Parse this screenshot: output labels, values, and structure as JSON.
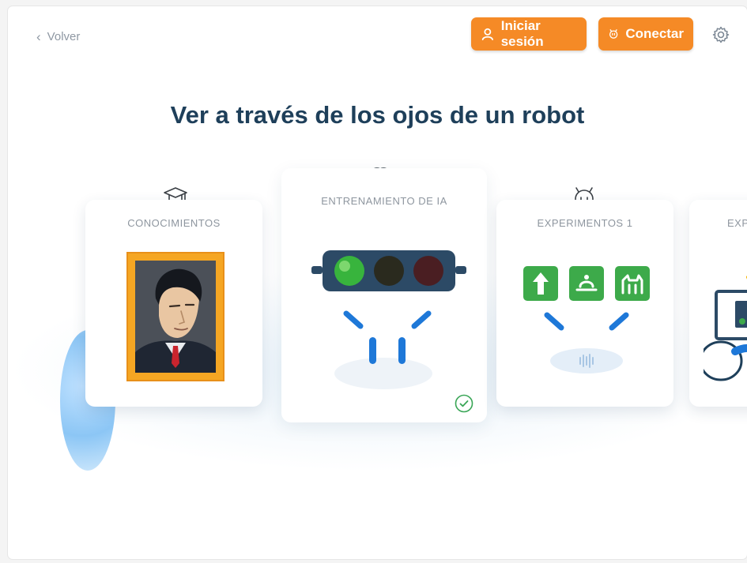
{
  "nav": {
    "back_label": "Volver",
    "login_label": "Iniciar sesión",
    "connect_label": "Conectar"
  },
  "page": {
    "title": "Ver a través de los ojos de un robot"
  },
  "cards": [
    {
      "label": "CONOCIMIENTOS",
      "icon": "graduation-cap-icon"
    },
    {
      "label": "ENTRENAMIENTO DE IA",
      "icon": "brain-icon",
      "completed": true
    },
    {
      "label": "EXPERIMENTOS 1",
      "icon": "robot-face-icon"
    },
    {
      "label": "EXP",
      "icon": ""
    }
  ],
  "colors": {
    "accent": "#f58a26",
    "title": "#1e3f5a",
    "label": "#8e969f",
    "eye_blue": "#1e78d8",
    "check_green": "#3aa657"
  }
}
